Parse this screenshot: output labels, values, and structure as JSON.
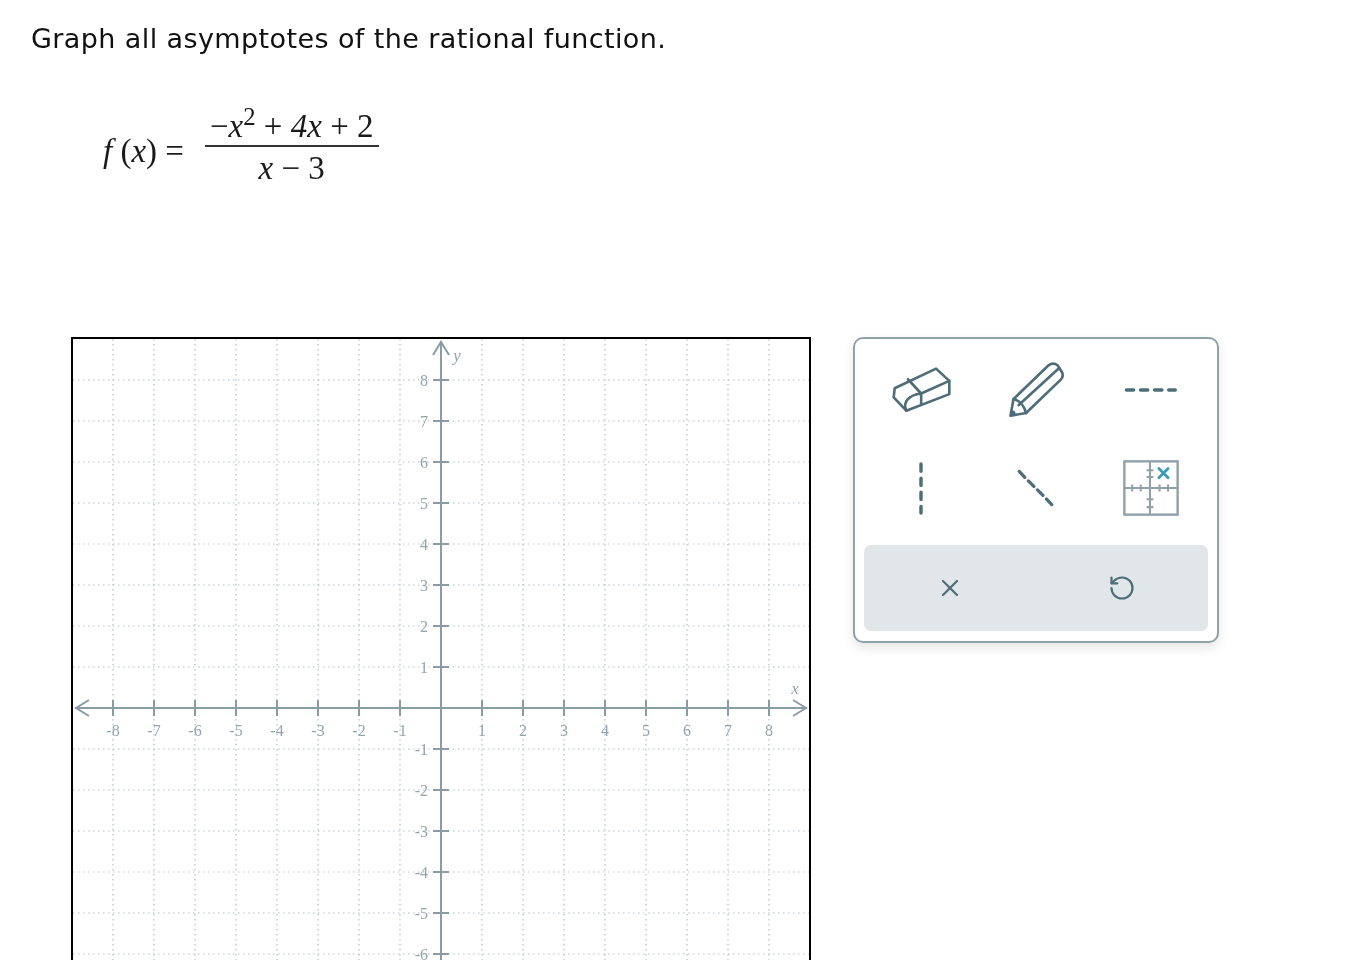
{
  "prompt": "Graph all asymptotes of the rational function.",
  "function": {
    "lhs": "*f* (*x*) =",
    "numerator": "−*x*$^{2}$ + *4x* + 2",
    "denominator": "*x* − 3"
  },
  "graph": {
    "x_axis_label": "x",
    "y_axis_label": "y",
    "x_tick_labels": [
      "-8",
      "-7",
      "-6",
      "-5",
      "-4",
      "-3",
      "-2",
      "-1",
      "1",
      "2",
      "3",
      "4",
      "5",
      "6",
      "7",
      "8"
    ],
    "y_tick_labels": [
      "8",
      "7",
      "6",
      "5",
      "4",
      "3",
      "2",
      "1",
      "-1",
      "-2",
      "-3",
      "-4",
      "-5",
      "-6"
    ]
  }
}
